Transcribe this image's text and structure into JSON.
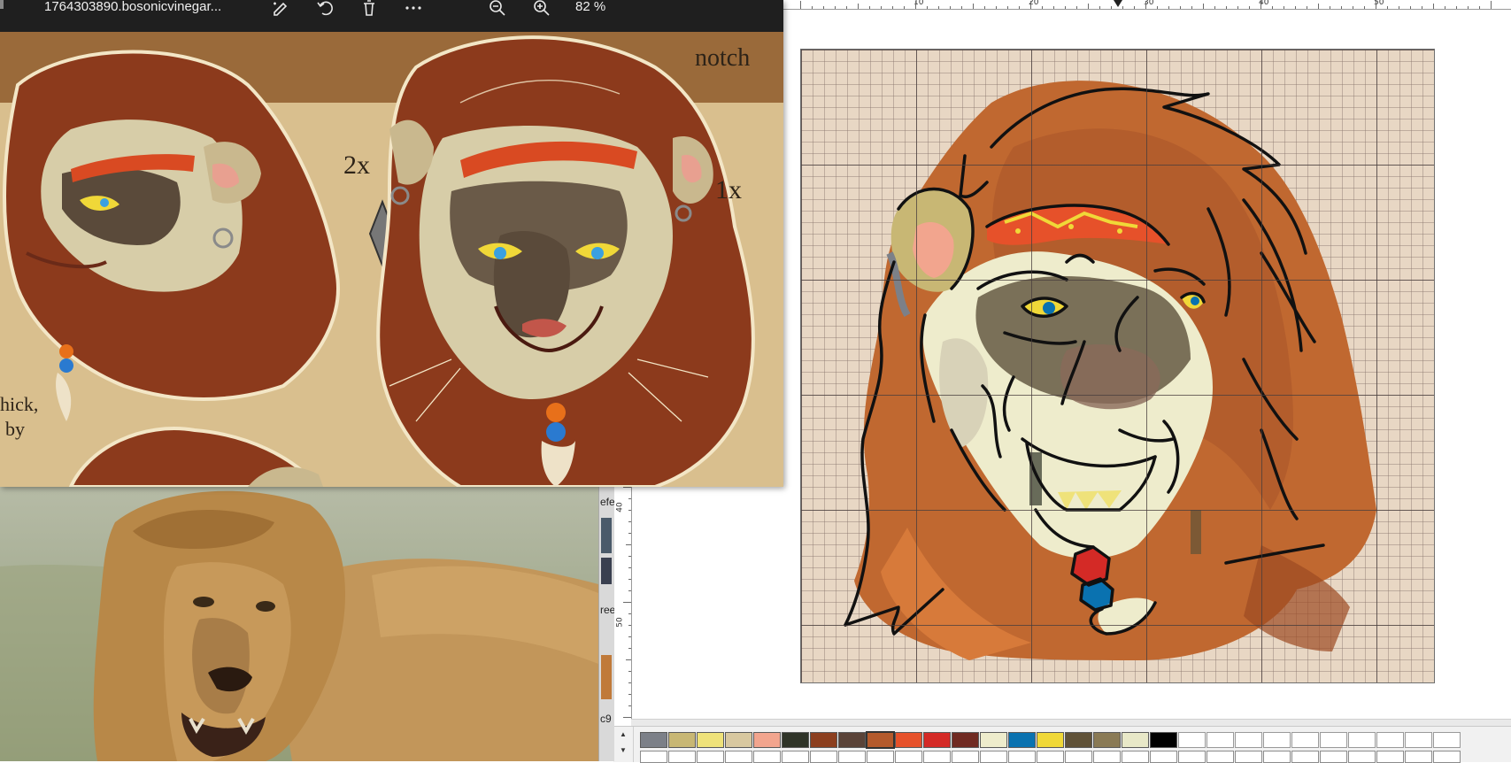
{
  "viewer": {
    "title": "1764303890.bosonicvinegar...",
    "zoom": "82 %",
    "toolbar_icons": [
      "edit-image-icon",
      "rotate-icon",
      "delete-icon",
      "more-icon",
      "zoom-out-icon",
      "zoom-in-icon"
    ],
    "sheet_labels": {
      "notch": "notch",
      "two_x": "2x",
      "one_x": "1x",
      "cut_line1": "hick,",
      "cut_line2": "by"
    }
  },
  "behind_window": {
    "text1": "efe",
    "text2": "ree",
    "text3": "c9"
  },
  "editor": {
    "ruler_top_numbers": [
      "10",
      "20",
      "30",
      "40",
      "50"
    ],
    "ruler_left_numbers": [
      "40",
      "50"
    ],
    "palette": [
      "#7c8088",
      "#c8b774",
      "#efe27a",
      "#d8c8a0",
      "#f2a58e",
      "#2f3428",
      "#8c3f1f",
      "#5a4338",
      "#b45a2c",
      "#e6512a",
      "#d42a26",
      "#702a22",
      "#eeeccc",
      "#0a72b0",
      "#f0d838",
      "#605238",
      "#8a7a55",
      "#e8e8c8",
      "#000000"
    ],
    "selected_swatch_index": 8
  }
}
